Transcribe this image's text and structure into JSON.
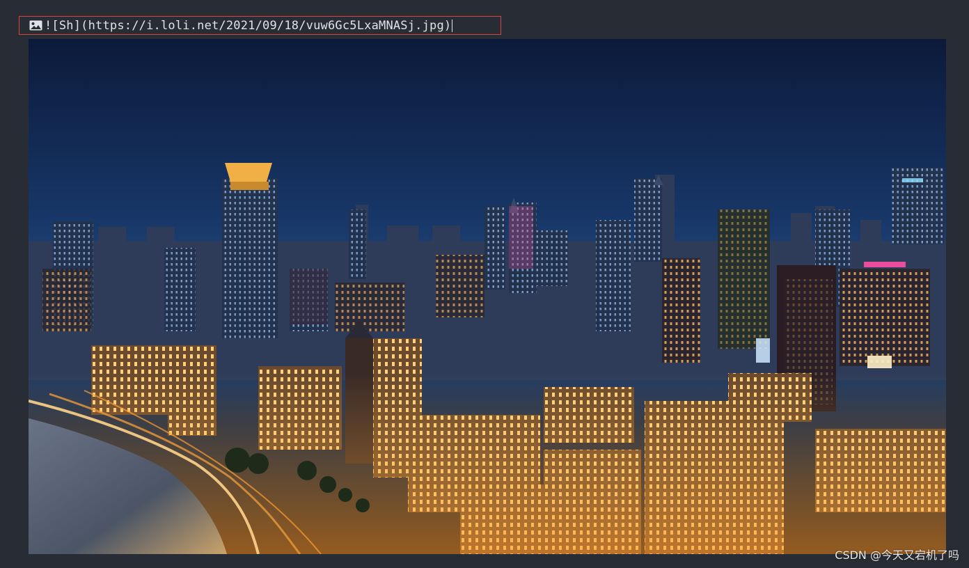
{
  "editor": {
    "markdown_line": "![Sh](https://i.loli.net/2021/09/18/vuw6Gc5LxaMNASj.jpg)"
  },
  "preview": {
    "image_icon": "image-icon",
    "alt": "Sh"
  },
  "watermark": {
    "text": "CSDN @今天又宕机了吗"
  },
  "colors": {
    "background": "#282c34",
    "border_highlight": "#d9433f",
    "text": "#dfe3ea"
  }
}
